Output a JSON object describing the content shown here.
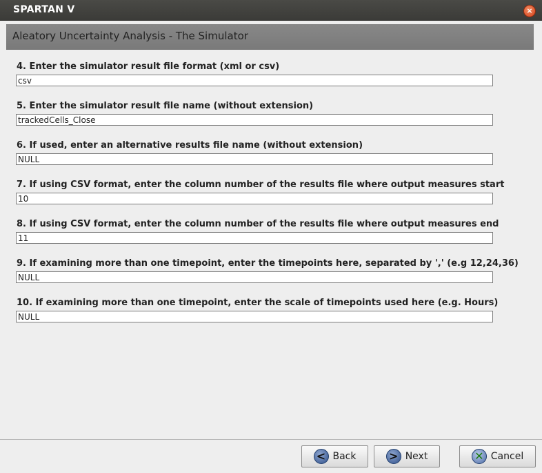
{
  "window": {
    "title": "SPARTAN V",
    "close_symbol": "×"
  },
  "header": {
    "title": "Aleatory Uncertainty Analysis - The Simulator"
  },
  "questions": [
    {
      "label": "4. Enter the simulator result file format (xml or csv)",
      "value": "csv"
    },
    {
      "label": "5. Enter the simulator result file name (without extension)",
      "value": "trackedCells_Close"
    },
    {
      "label": "6. If used, enter an alternative results file name (without extension)",
      "value": "NULL"
    },
    {
      "label": "7. If using CSV format, enter the column number of the results file where output measures start",
      "value": "10"
    },
    {
      "label": "8. If using CSV format, enter the column number of the results file where output measures end",
      "value": "11"
    },
    {
      "label": "9. If examining more than one timepoint, enter the timepoints here, separated by ',' (e.g 12,24,36)",
      "value": "NULL"
    },
    {
      "label": "10. If examining more than one timepoint, enter the scale of timepoints used here (e.g. Hours)",
      "value": "NULL"
    }
  ],
  "buttons": {
    "back": {
      "label": "Back",
      "icon_glyph": "<"
    },
    "next": {
      "label": "Next",
      "icon_glyph": ">"
    },
    "cancel": {
      "label": "Cancel",
      "icon_glyph": "✕"
    }
  }
}
